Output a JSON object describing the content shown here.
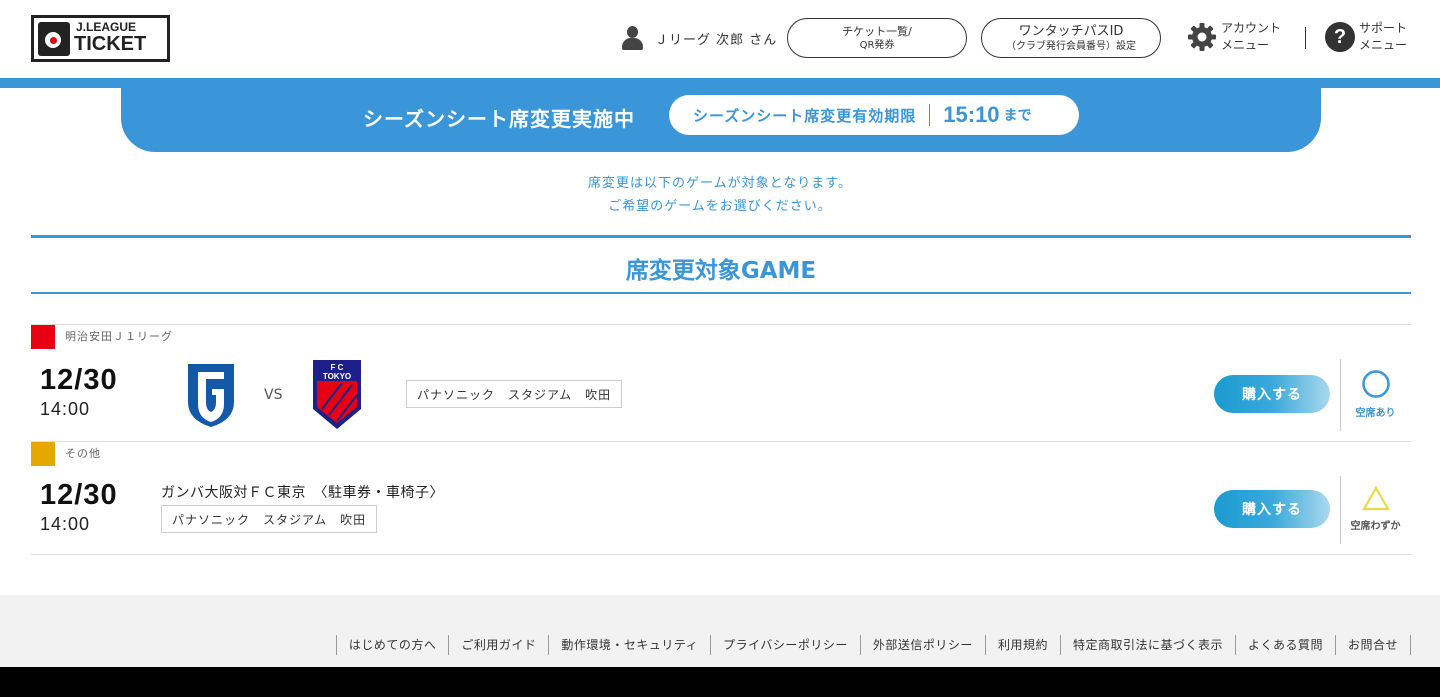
{
  "header": {
    "logo_line1": "J.LEAGUE",
    "logo_line2": "TICKET",
    "user_name": "Ｊリーグ 次郎 さん",
    "ticket_btn_line1": "チケット一覧/",
    "ticket_btn_line2": "QR発券",
    "onetouch_btn_line1": "ワンタッチパスID",
    "onetouch_btn_line2": "（クラブ発行会員番号）設定",
    "account_line1": "アカウント",
    "account_line2": "メニュー",
    "support_line1": "サポート",
    "support_line2": "メニュー",
    "support_icon_glyph": "?"
  },
  "banner": {
    "title": "シーズンシート席変更実施中",
    "deadline_label": "シーズンシート席変更有効期限",
    "deadline_time": "15:10",
    "deadline_suffix": "まで"
  },
  "notice": {
    "line1": "席変更は以下のゲームが対象となります。",
    "line2": "ご希望のゲームをお選びください。"
  },
  "section_title": "席変更対象GAME",
  "games": [
    {
      "league": "明治安田Ｊ１リーグ",
      "league_color": "#e60012",
      "date": "12/30",
      "time": "14:00",
      "vs": "VS",
      "home_logo": "gamba-osaka-emblem",
      "away_logo": "fc-tokyo-emblem",
      "venue": "パナソニック　スタジアム　吹田",
      "buy_label": "購入する",
      "availability": "空席あり",
      "availability_icon": "circle-icon",
      "availability_color": "#3a96d8"
    },
    {
      "league": "その他",
      "league_color": "#e6a800",
      "date": "12/30",
      "time": "14:00",
      "game_name": "ガンバ大阪対ＦＣ東京　〈駐車券・車椅子〉",
      "venue": "パナソニック　スタジアム　吹田",
      "buy_label": "購入する",
      "availability": "空席わずか",
      "availability_icon": "triangle-icon",
      "availability_color": "#e8d84a"
    }
  ],
  "footer": {
    "links": [
      "はじめての方へ",
      "ご利用ガイド",
      "動作環境・セキュリティ",
      "プライバシーポリシー",
      "外部送信ポリシー",
      "利用規約",
      "特定商取引法に基づく表示",
      "よくある質問",
      "お問合せ"
    ]
  },
  "colors": {
    "accent": "#3a96d8",
    "buy_gradient_start": "#1a9bd0",
    "buy_gradient_end": "#a9d8ee"
  }
}
